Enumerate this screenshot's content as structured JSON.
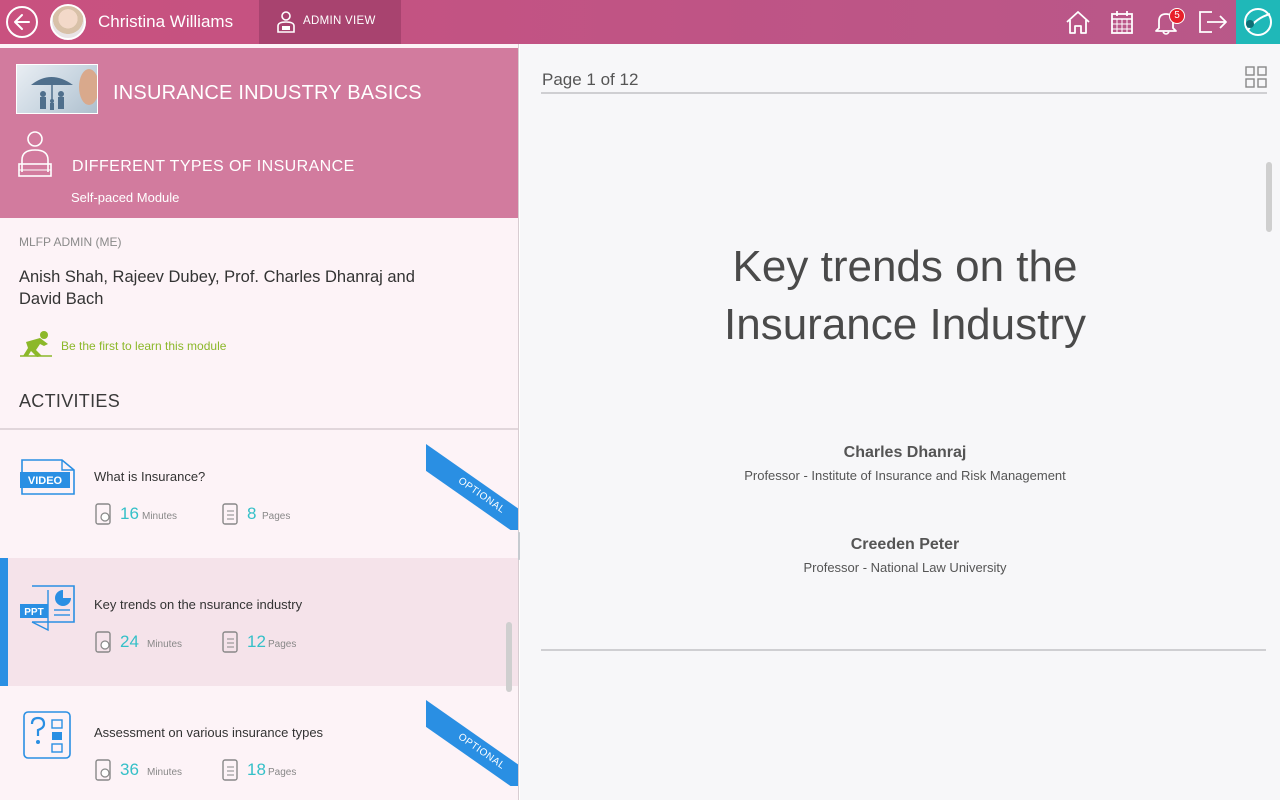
{
  "header": {
    "user_name": "Christina Williams",
    "admin_view_label": "ADMIN VIEW",
    "notification_count": "5",
    "accent_color": "#c9517f",
    "icons": [
      "back-icon",
      "avatar",
      "admin-icon",
      "home-icon",
      "calendar-icon",
      "bell-icon",
      "logout-icon",
      "app-logo-icon"
    ]
  },
  "course": {
    "title": "INSURANCE INDUSTRY BASICS",
    "module_title": "DIFFERENT TYPES OF INSURANCE",
    "module_type": "Self-paced Module",
    "author_role": "MLFP ADMIN (ME)",
    "authors": "Anish Shah, Rajeev Dubey, Prof. Charles Dhanraj and David Bach",
    "first_learn": "Be the first to learn this module"
  },
  "activities": {
    "heading": "ACTIVITIES",
    "items": [
      {
        "title": "What is Insurance?",
        "type": "video",
        "minutes": "16",
        "minutes_label": "Minutes",
        "pages": "8",
        "pages_label": "Pages",
        "ribbon": "OPTIONAL",
        "selected": false
      },
      {
        "title": "Key trends on the nsurance industry",
        "type": "ppt",
        "minutes": "24",
        "minutes_label": "Minutes",
        "pages": "12",
        "pages_label": "Pages",
        "ribbon": "",
        "selected": true
      },
      {
        "title": "Assessment on various insurance types",
        "type": "assessment",
        "minutes": "36",
        "minutes_label": "Minutes",
        "pages": "18",
        "pages_label": "Pages",
        "ribbon": "OPTIONAL",
        "selected": false
      }
    ]
  },
  "viewer": {
    "page_indicator": "Page 1 of 12",
    "slide_title_line1": "Key trends on the",
    "slide_title_line2": "Insurance Industry",
    "speakers": [
      {
        "name": "Charles Dhanraj",
        "role": "Professor - Institute of Insurance and Risk Management"
      },
      {
        "name": "Creeden Peter",
        "role": "Professor - National Law University"
      }
    ]
  }
}
